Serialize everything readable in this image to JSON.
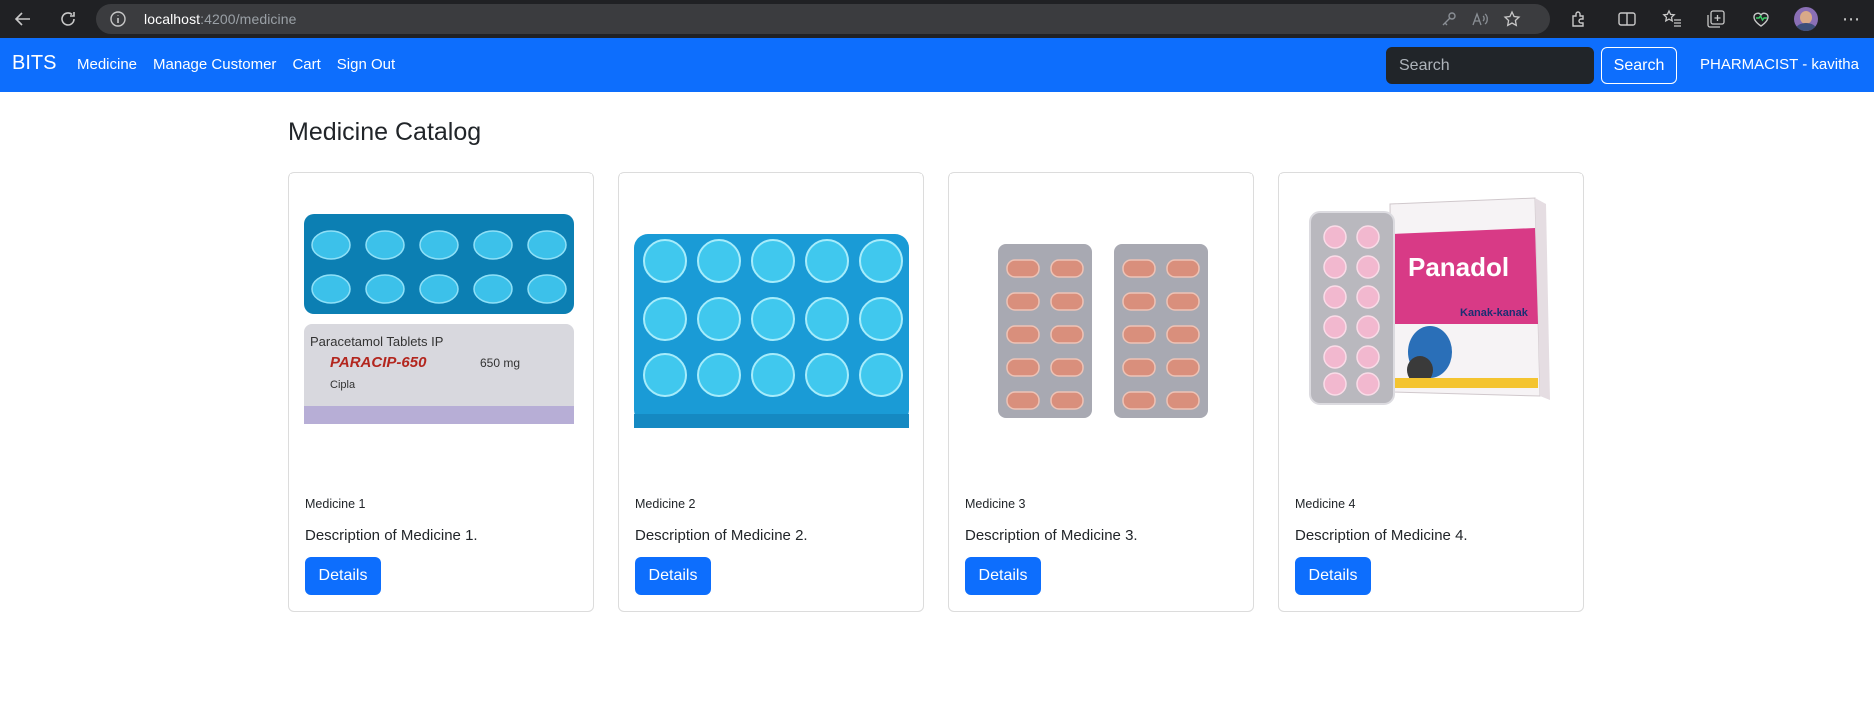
{
  "browser": {
    "url_host": "localhost",
    "url_path": ":4200/medicine"
  },
  "navbar": {
    "brand": "BITS",
    "links": [
      {
        "label": "Medicine"
      },
      {
        "label": "Manage Customer"
      },
      {
        "label": "Cart"
      },
      {
        "label": "Sign Out"
      }
    ],
    "search_placeholder": "Search",
    "search_button": "Search",
    "user": "PHARMACIST - kavitha",
    "color": "#0d6efd"
  },
  "main": {
    "title": "Medicine Catalog",
    "cards": [
      {
        "name": "Medicine 1",
        "description": "Description of Medicine 1.",
        "button": "Details",
        "image": "blue-tablet-strip-paracip-650"
      },
      {
        "name": "Medicine 2",
        "description": "Description of Medicine 2.",
        "button": "Details",
        "image": "blue-tablet-strip"
      },
      {
        "name": "Medicine 3",
        "description": "Description of Medicine 3.",
        "button": "Details",
        "image": "pink-tablet-blister-packs"
      },
      {
        "name": "Medicine 4",
        "description": "Description of Medicine 4.",
        "button": "Details",
        "image": "panadol-kanak-kanak-box"
      }
    ],
    "product_labels": {
      "paracip_strip": [
        "PARACIP-650",
        "650 mg",
        "Paracetamol Tablets IP",
        "Cipla"
      ],
      "panadol_box": [
        "Panadol",
        "Kanak-kanak"
      ]
    }
  }
}
